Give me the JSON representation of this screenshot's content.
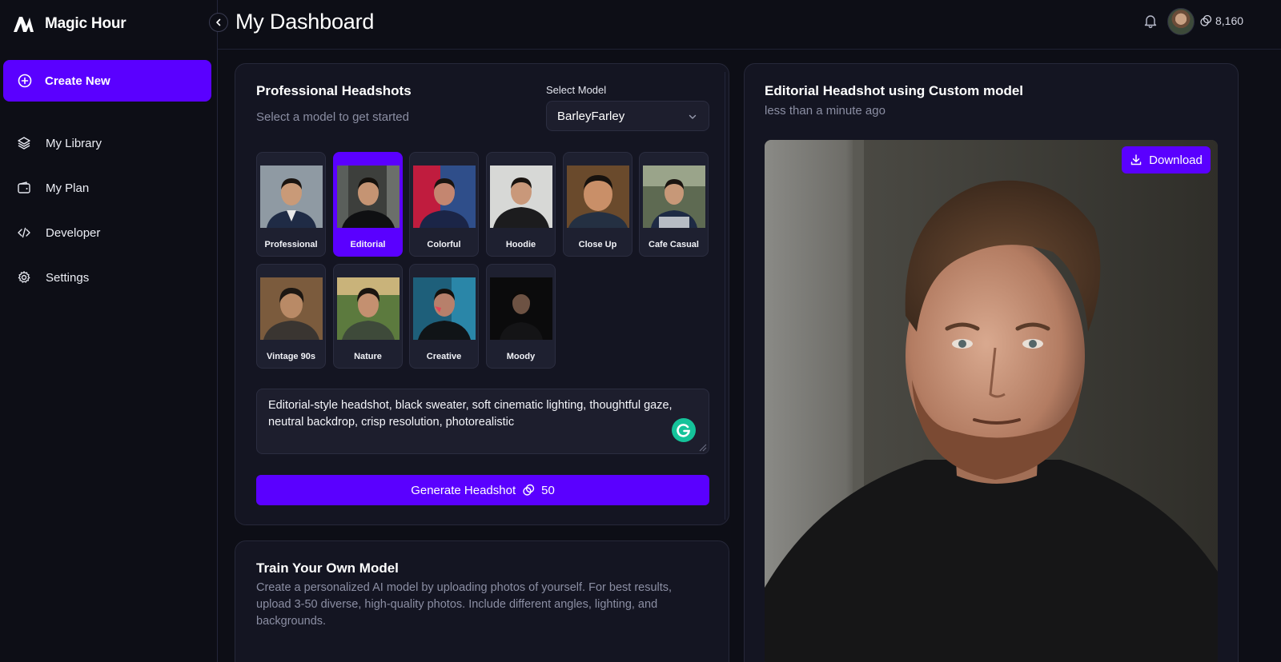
{
  "app": {
    "name": "Magic Hour"
  },
  "sidebar": {
    "create_label": "Create New",
    "items": [
      {
        "label": "My Library",
        "icon": "layers-icon"
      },
      {
        "label": "My Plan",
        "icon": "wallet-icon"
      },
      {
        "label": "Developer",
        "icon": "code-icon"
      },
      {
        "label": "Settings",
        "icon": "gear-icon"
      }
    ]
  },
  "header": {
    "title": "My Dashboard",
    "credits": "8,160"
  },
  "headshots": {
    "title": "Professional Headshots",
    "subtitle": "Select a model to get started",
    "select_label": "Select Model",
    "selected_model": "BarleyFarley",
    "styles": [
      {
        "label": "Professional",
        "selected": false
      },
      {
        "label": "Editorial",
        "selected": true
      },
      {
        "label": "Colorful",
        "selected": false
      },
      {
        "label": "Hoodie",
        "selected": false
      },
      {
        "label": "Close Up",
        "selected": false
      },
      {
        "label": "Cafe Casual",
        "selected": false
      },
      {
        "label": "Vintage 90s",
        "selected": false
      },
      {
        "label": "Nature",
        "selected": false
      },
      {
        "label": "Creative",
        "selected": false
      },
      {
        "label": "Moody",
        "selected": false
      }
    ],
    "prompt": "Editorial-style headshot, black sweater, soft cinematic lighting, thoughtful gaze, neutral backdrop, crisp resolution, photorealistic",
    "generate_label": "Generate Headshot",
    "generate_cost": "50"
  },
  "train": {
    "title": "Train Your Own Model",
    "description": "Create a personalized AI model by uploading photos of yourself. For best results, upload 3-50 diverse, high-quality photos. Include different angles, lighting, and backgrounds."
  },
  "result": {
    "title": "Editorial Headshot using Custom model",
    "time": "less than a minute ago",
    "download_label": "Download"
  },
  "colors": {
    "accent": "#5a00ff",
    "background": "#0d0e16",
    "card": "#141522",
    "muted_text": "#8b8ea3"
  }
}
